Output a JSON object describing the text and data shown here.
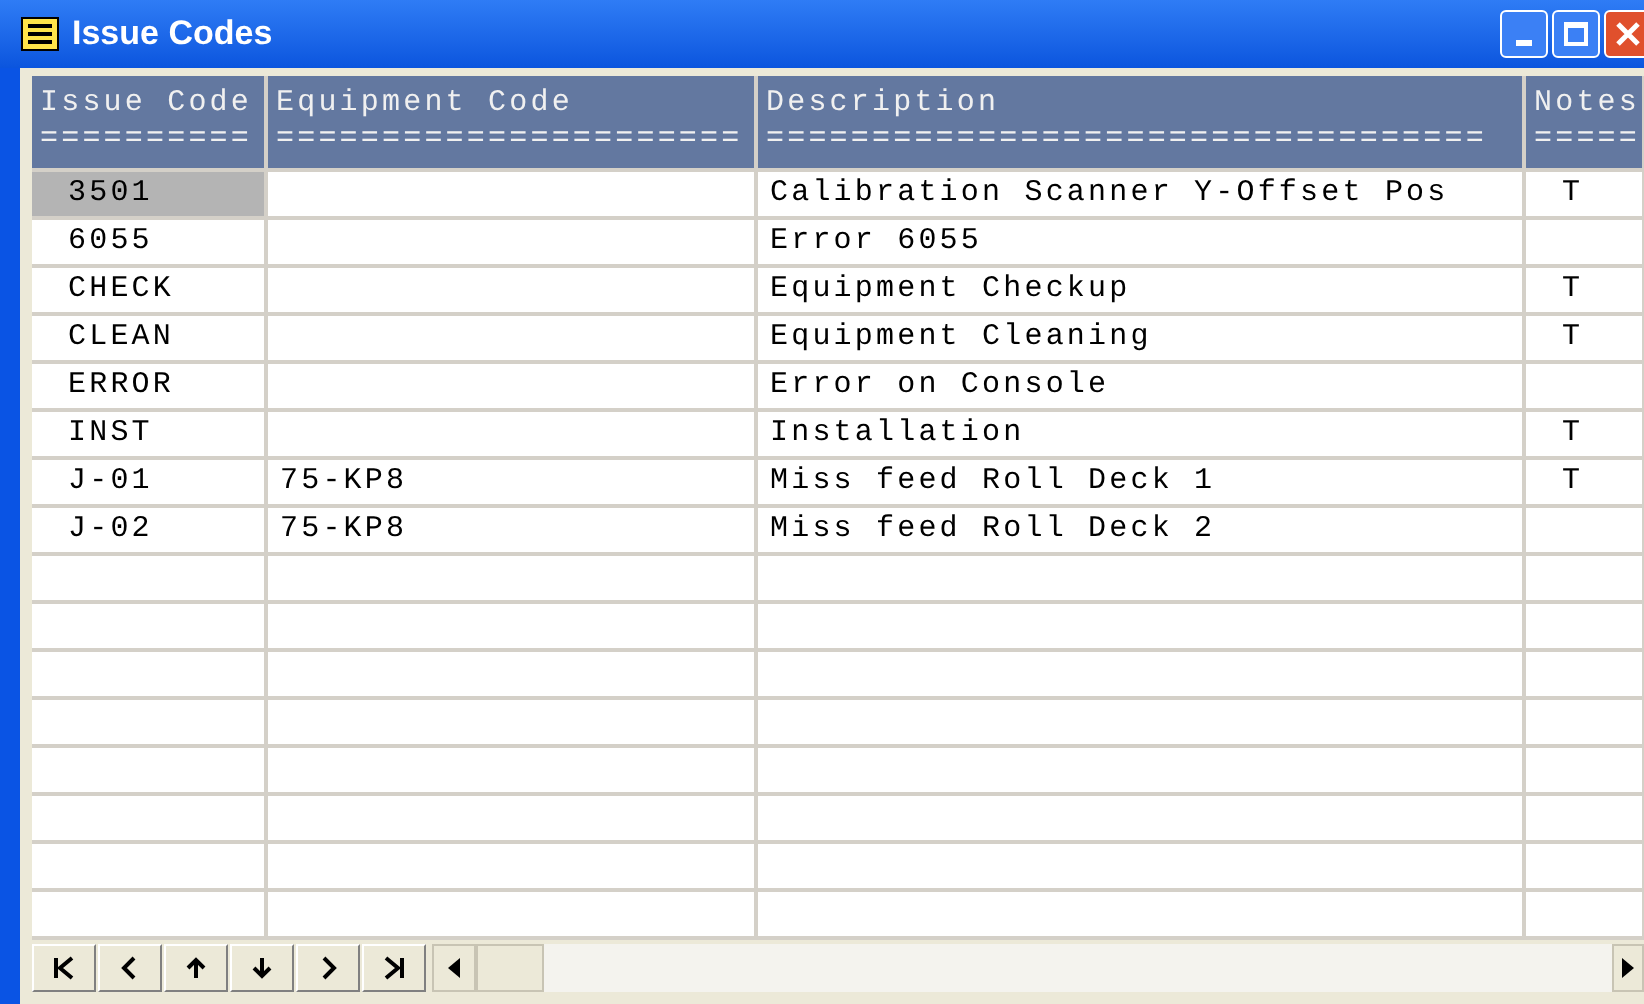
{
  "window": {
    "title": "Issue Codes"
  },
  "table": {
    "columns": [
      {
        "label": "Issue Code",
        "rule": "=========="
      },
      {
        "label": "Equipment Code",
        "rule": "======================"
      },
      {
        "label": "Description",
        "rule": "=================================="
      },
      {
        "label": "Notes",
        "rule": "====="
      }
    ],
    "rows": [
      {
        "selected": true,
        "cells": [
          "3501",
          "",
          "Calibration Scanner Y-Offset Pos",
          "T"
        ]
      },
      {
        "selected": false,
        "cells": [
          "6055",
          "",
          "Error 6055",
          ""
        ]
      },
      {
        "selected": false,
        "cells": [
          "CHECK",
          "",
          "Equipment Checkup",
          "T"
        ]
      },
      {
        "selected": false,
        "cells": [
          "CLEAN",
          "",
          "Equipment Cleaning",
          "T"
        ]
      },
      {
        "selected": false,
        "cells": [
          "ERROR",
          "",
          "Error on Console",
          ""
        ]
      },
      {
        "selected": false,
        "cells": [
          "INST",
          "",
          "Installation",
          "T"
        ]
      },
      {
        "selected": false,
        "cells": [
          "J-01",
          "75-KP8",
          "Miss feed Roll Deck 1",
          "T"
        ]
      },
      {
        "selected": false,
        "cells": [
          "J-02",
          "75-KP8",
          "Miss feed Roll Deck 2",
          ""
        ]
      }
    ]
  }
}
